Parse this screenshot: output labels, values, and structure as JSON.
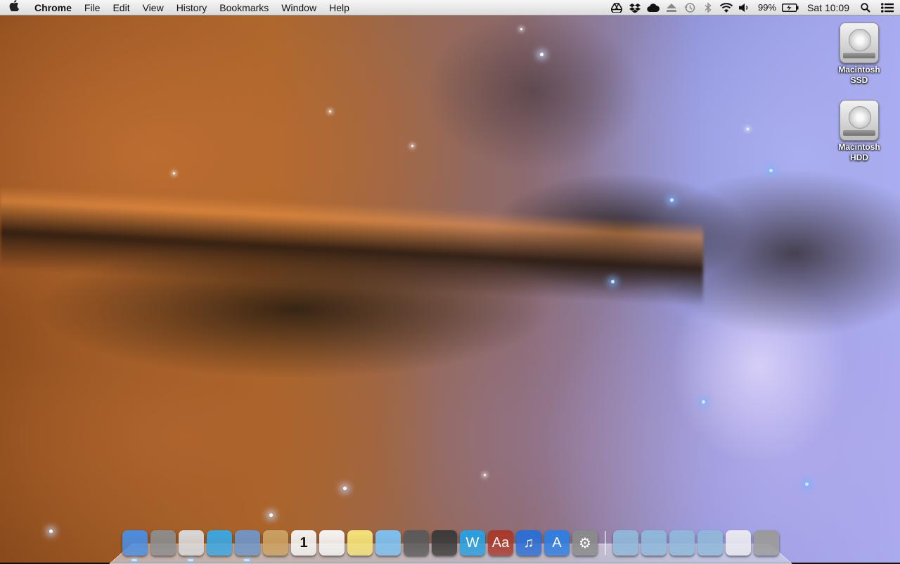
{
  "menubar": {
    "apple_icon": "apple-logo-icon",
    "app_name": "Chrome",
    "menus": [
      "File",
      "Edit",
      "View",
      "History",
      "Bookmarks",
      "Window",
      "Help"
    ],
    "status_icons": [
      "google-drive-icon",
      "dropbox-icon",
      "cloud-icon",
      "eject-icon",
      "time-machine-icon",
      "bluetooth-icon",
      "wifi-icon",
      "volume-icon"
    ],
    "battery_percent": "99%",
    "battery_icon": "battery-charging-icon",
    "clock": "Sat 10:09",
    "search_icon": "spotlight-search-icon",
    "notifications_icon": "notification-center-icon"
  },
  "desktop": {
    "icons": [
      {
        "label_line1": "Macintosh",
        "label_line2": "SSD",
        "icon": "hard-drive-icon"
      },
      {
        "label_line1": "Macintosh",
        "label_line2": "HDD",
        "icon": "hard-drive-icon"
      }
    ]
  },
  "dock": {
    "apps": [
      {
        "name": "finder-icon",
        "color": "#4a8de0"
      },
      {
        "name": "launchpad-icon",
        "color": "#8c8c8c"
      },
      {
        "name": "chrome-icon",
        "color": "#d8d8d8"
      },
      {
        "name": "twitter-icon",
        "color": "#3aa6e0"
      },
      {
        "name": "mail-icon",
        "color": "#6f95c6"
      },
      {
        "name": "contacts-icon",
        "color": "#c9a062"
      },
      {
        "name": "calendar-icon",
        "color": "#f2f2f2",
        "text": "1"
      },
      {
        "name": "reminders-icon",
        "color": "#f4f4f4"
      },
      {
        "name": "notes-icon",
        "color": "#f3e27a"
      },
      {
        "name": "messages-icon",
        "color": "#7cc0f0"
      },
      {
        "name": "facetime-icon",
        "color": "#5a5a5a"
      },
      {
        "name": "disk-utility-icon",
        "color": "#3b3b3b"
      },
      {
        "name": "word-icon",
        "color": "#2a9fe0",
        "text": "W"
      },
      {
        "name": "dictionary-icon",
        "color": "#a83a2c",
        "text": "Aa"
      },
      {
        "name": "itunes-icon",
        "color": "#2b6fd6",
        "text": "♫"
      },
      {
        "name": "app-store-icon",
        "color": "#2f7ee0",
        "text": "A"
      },
      {
        "name": "system-preferences-icon",
        "color": "#8a8a8a",
        "text": "⚙"
      }
    ],
    "stacks": [
      {
        "name": "dropbox-folder-icon",
        "color": "#8fb7d8"
      },
      {
        "name": "cloud-folder-icon",
        "color": "#8fb7d8"
      },
      {
        "name": "documents-folder-icon",
        "color": "#8fb7d8"
      },
      {
        "name": "downloads-folder-icon",
        "color": "#8fb7d8"
      },
      {
        "name": "chrome-apps-stack-icon",
        "color": "#e8e8ee"
      },
      {
        "name": "trash-icon",
        "color": "#9a9a9a"
      }
    ]
  }
}
